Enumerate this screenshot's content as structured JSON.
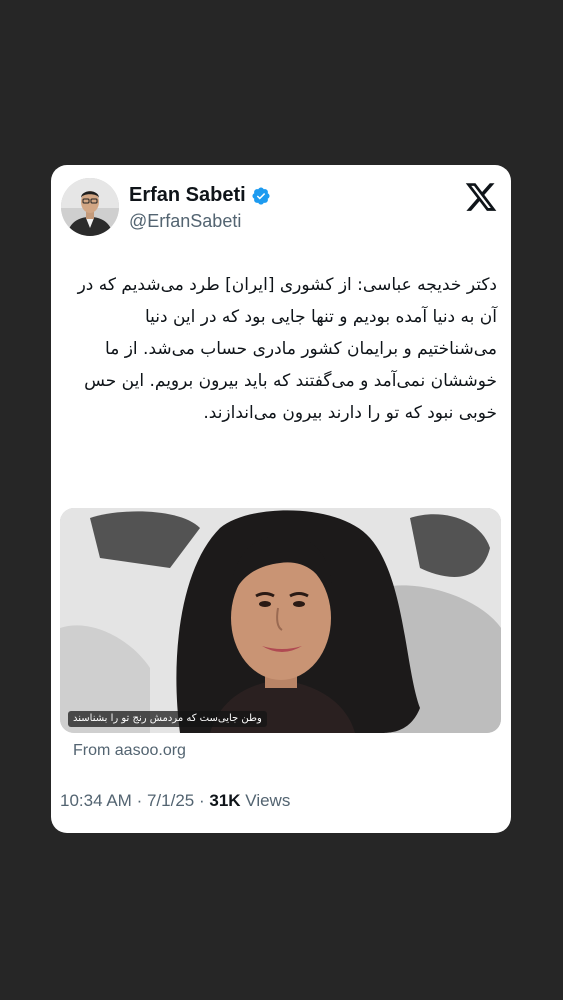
{
  "tweet": {
    "author_name": "Erfan Sabeti",
    "handle": "@ErfanSabeti",
    "text": "دکتر خدیجه عباسی: از کشوری [ایران] طرد می‌شدیم که در آن به دنیا آمده بودیم و تنها جایی بود که در این دنیا می‌شناختیم و برایمان کشور مادری حساب می‌شد. از ما خوششان نمی‌آمد و می‌گفتند که باید بیرون برویم. این حس خوبی نبود که تو را دارند بیرون می‌اندازند.",
    "media_caption": "وطن جایی‌ست که مردمش رنج تو را بشناسند",
    "link_source": "From aasoo.org",
    "time": "10:34 AM",
    "separator": "·",
    "date": "7/1/25",
    "views_count": "31K",
    "views_label": "Views"
  },
  "icons": {
    "verified": "verified-badge-icon",
    "brand": "x-logo-icon"
  },
  "colors": {
    "background": "#262626",
    "card": "#ffffff",
    "verified_blue": "#1d9bf0",
    "secondary_text": "#536471",
    "primary_text": "#0f1419"
  }
}
